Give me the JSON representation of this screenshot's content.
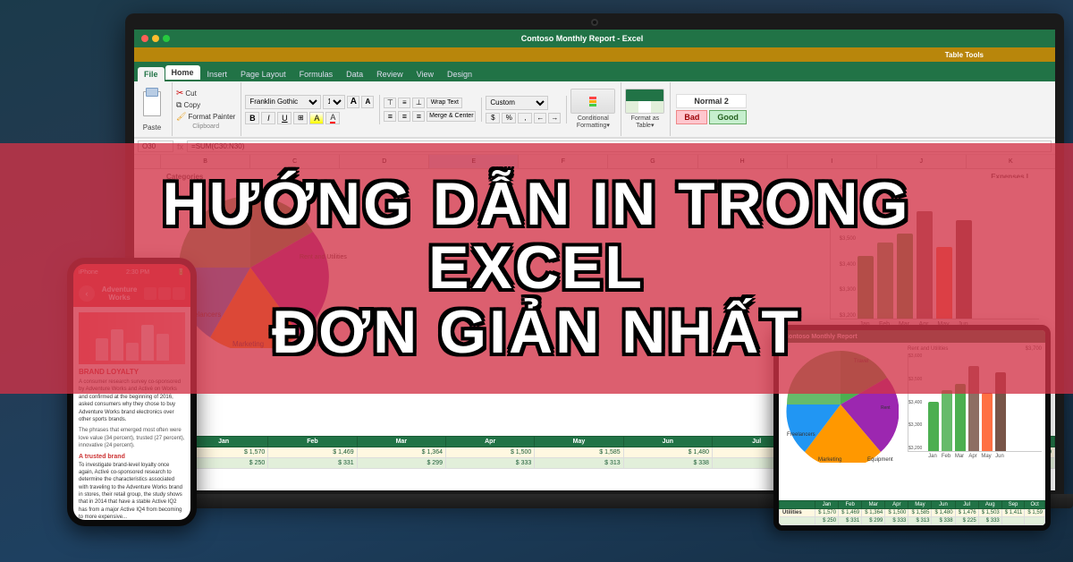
{
  "page": {
    "title": "Hướng Dẫn In Trong Excel Đơn Giản Nhất",
    "title_line1": "HƯỚNG DẪN IN TRONG EXCEL",
    "title_line2": "ĐƠN GIẢN NHẤT"
  },
  "excel": {
    "window_title": "Contoso Monthly Report - Excel",
    "tab_tools": "Table Tools",
    "active_tab": "Home",
    "tabs": [
      "File",
      "Home",
      "Insert",
      "Page Layout",
      "Formulas",
      "Data",
      "Review",
      "View",
      "Design"
    ],
    "clipboard_label": "Clipboard",
    "cut_label": "Cut",
    "copy_label": "Copy",
    "format_painter_label": "Format Painter",
    "paste_label": "Paste",
    "font_name": "Franklin Gothic",
    "font_size": "10",
    "wrap_text": "Wrap Text",
    "merge_center": "Merge & Center",
    "format_number": "Custom",
    "formula_bar": "=SUM(C30:N30)",
    "cell_ref": "O30",
    "styles": {
      "normal2": "Normal 2",
      "bad": "Bad",
      "good": "Good"
    }
  },
  "chart": {
    "pie_labels": [
      "Travel",
      "Freelancers",
      "Marketing",
      "Equipment",
      "Rent and Utilities"
    ],
    "pie_colors": [
      "#4CAF50",
      "#FF9800",
      "#2196F3",
      "#F44336",
      "#9C27B0"
    ],
    "bar_y_labels": [
      "$3,700",
      "$3,600",
      "$3,500",
      "$3,400",
      "$3,300",
      "$3,200"
    ],
    "bar_x_labels": [
      "Jan",
      "Feb",
      "Mar",
      "Apr",
      "May",
      "Jun"
    ],
    "expenses_label": "Expenses I",
    "bar_colors": [
      "#4CAF50",
      "#66BB6A",
      "#81C784",
      "#8D6E63",
      "#FF7043",
      "#795548"
    ]
  },
  "table": {
    "headers": [
      "",
      "Jan",
      "Feb",
      "Mar",
      "Apr",
      "May",
      "Jun",
      "Jul",
      "Aug",
      "Sep",
      "Oct"
    ],
    "rows": [
      {
        "label": "Utilities",
        "values": [
          "$ 1,570",
          "$ 1,469",
          "$ 1,364",
          "$ 1,500",
          "$ 1,585",
          "$ 1,480",
          "$ 1,476",
          "$ 1,503",
          "$ 1,411",
          "$ 1,59"
        ]
      },
      {
        "label": "",
        "values": [
          "$ 250",
          "$ 331",
          "$ 299",
          "$ 333",
          "$ 313",
          "$ 338",
          "$ 225",
          "$ 333",
          "",
          ""
        ]
      }
    ]
  },
  "phone": {
    "time": "2:30 PM",
    "signal": "iPhone",
    "brand_loyalty_title": "BRAND LOYALTY",
    "article_text": "A consumer research survey co-sponsored by Adventure Works and Activé on Works and confirmed at the beginning of 2016, asked consumers why they chose to buy Adventure Works brand electronics over other sports brands.",
    "subtext": "The phrases that emerged most often were love value (34 percent), trusted (27 percent), innovative (24 percent).",
    "trusted_brand": "A trusted brand"
  },
  "colors": {
    "excel_green": "#217346",
    "overlay_red": "rgba(220,60,80,0.75)",
    "chart_green1": "#4CAF50",
    "chart_green2": "#66BB6A",
    "chart_orange": "#FF9800",
    "chart_blue": "#2196F3",
    "chart_red": "#F44336",
    "chart_brown1": "#8D6E63",
    "chart_brown2": "#795548"
  }
}
